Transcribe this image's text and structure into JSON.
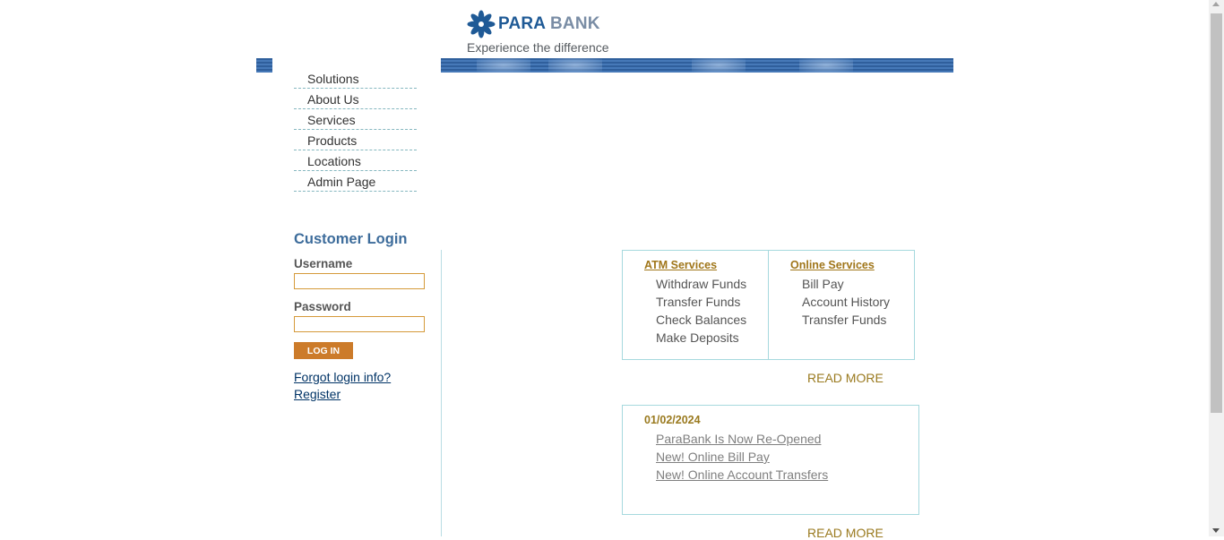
{
  "header": {
    "brand_part1": "PARA",
    "brand_part2": "BANK",
    "tagline": "Experience the difference",
    "logo_icon": "flower-logo-icon"
  },
  "nav": {
    "items": [
      {
        "label": "Solutions"
      },
      {
        "label": "About Us"
      },
      {
        "label": "Services"
      },
      {
        "label": "Products"
      },
      {
        "label": "Locations"
      },
      {
        "label": "Admin Page"
      }
    ]
  },
  "login": {
    "title": "Customer Login",
    "username_label": "Username",
    "username_value": "",
    "password_label": "Password",
    "password_value": "",
    "button_label": "LOG IN",
    "forgot_label": "Forgot login info?",
    "register_label": "Register"
  },
  "services": {
    "atm_title": "ATM Services",
    "atm_items": [
      "Withdraw Funds",
      "Transfer Funds",
      "Check Balances",
      "Make Deposits"
    ],
    "online_title": "Online Services",
    "online_items": [
      "Bill Pay",
      "Account History",
      "Transfer Funds"
    ],
    "read_more": "READ MORE"
  },
  "news": {
    "date": "01/02/2024",
    "items": [
      "ParaBank Is Now Re-Opened",
      "New! Online Bill Pay",
      "New! Online Account Transfers"
    ],
    "read_more": "READ MORE"
  },
  "colors": {
    "brand_blue": "#1f5a96",
    "accent_orange": "#cc7b2a",
    "accent_gold": "#9a7a1f",
    "border_teal": "#a6d9de"
  }
}
